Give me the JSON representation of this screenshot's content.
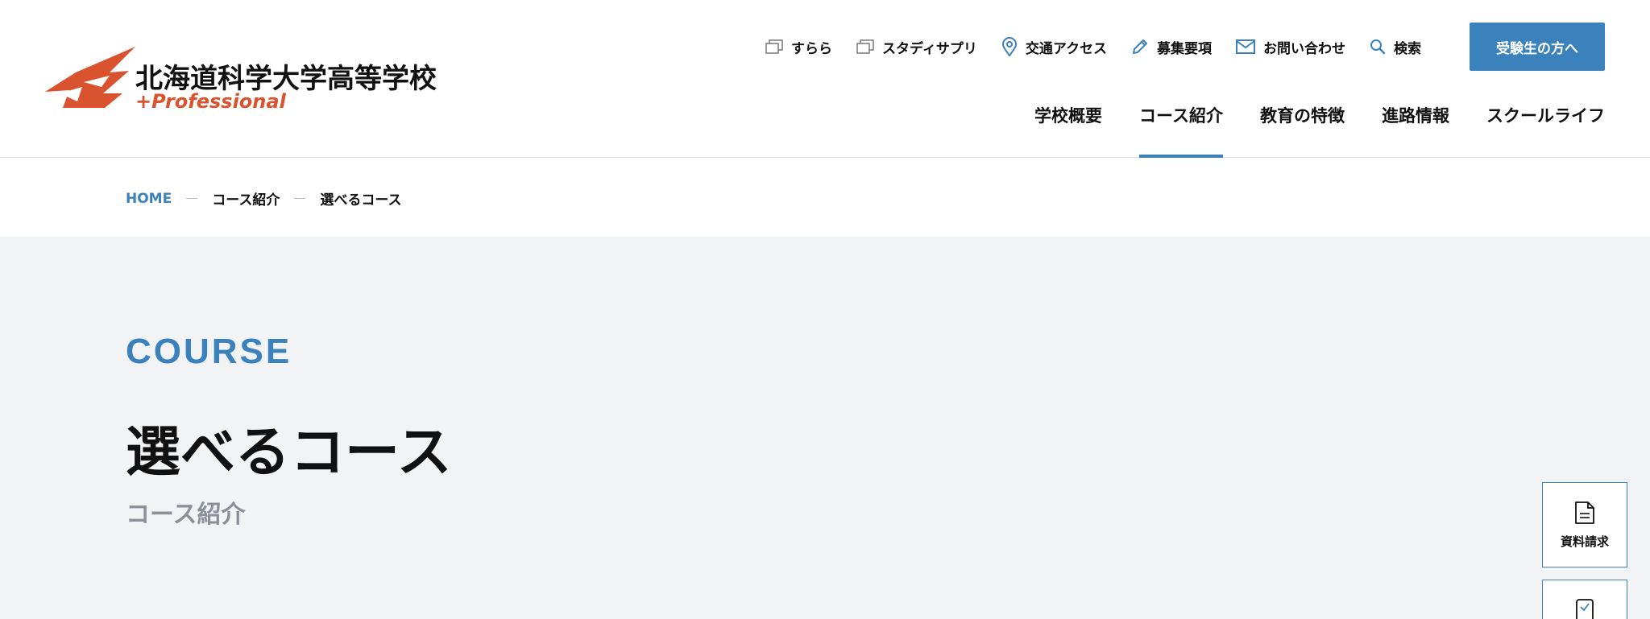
{
  "brand": {
    "school_name": "北海道科学大学高等学校",
    "tagline": "+Professional",
    "accent_color": "#3b82bd",
    "logo_color": "#d9532f"
  },
  "utility_nav": [
    {
      "label": "すらら",
      "icon": "window-icon"
    },
    {
      "label": "スタディサプリ",
      "icon": "window-icon"
    },
    {
      "label": "交通アクセス",
      "icon": "map-pin-icon"
    },
    {
      "label": "募集要項",
      "icon": "pencil-icon"
    },
    {
      "label": "お問い合わせ",
      "icon": "mail-icon"
    },
    {
      "label": "検索",
      "icon": "search-icon"
    }
  ],
  "cta": {
    "label": "受験生の方へ"
  },
  "main_nav": [
    {
      "label": "学校概要"
    },
    {
      "label": "コース紹介",
      "active": true
    },
    {
      "label": "教育の特徴"
    },
    {
      "label": "進路情報"
    },
    {
      "label": "スクールライフ"
    }
  ],
  "breadcrumb": {
    "home": "HOME",
    "parent": "コース紹介",
    "current": "選べるコース"
  },
  "hero": {
    "eyebrow": "COURSE",
    "title": "選べるコース",
    "subtitle": "コース紹介"
  },
  "side": {
    "docs_label": "資料請求",
    "docs_icon": "document-icon",
    "next_icon": "phone-check-icon"
  }
}
